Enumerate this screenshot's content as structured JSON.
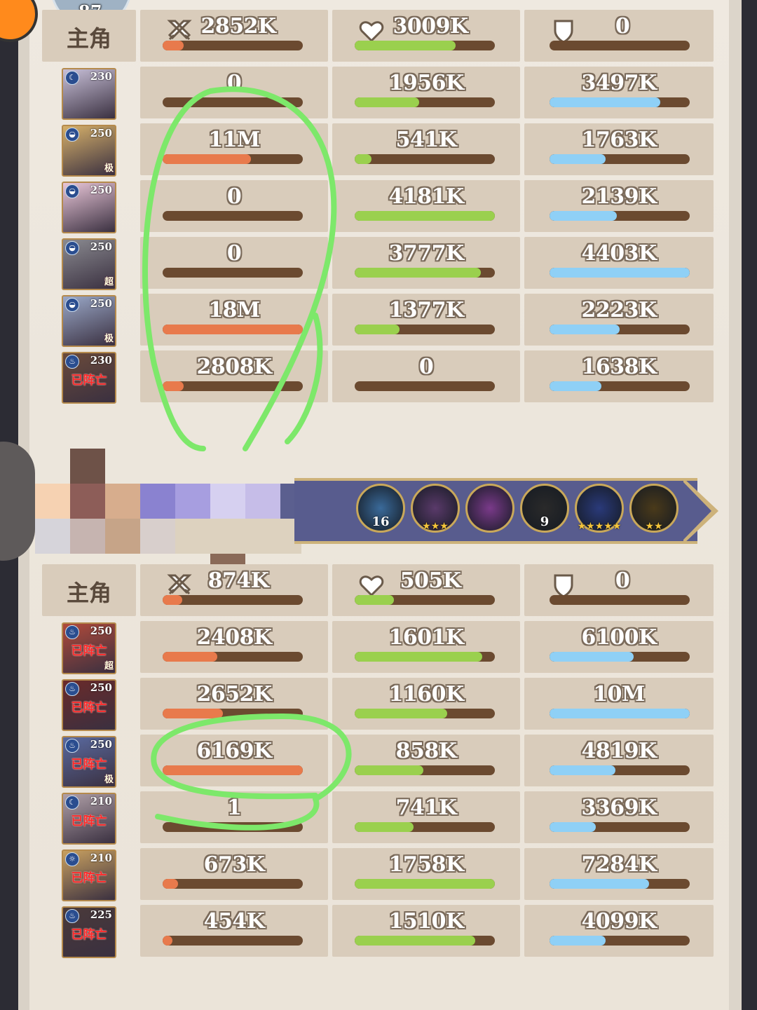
{
  "top_badge": {
    "level": "87"
  },
  "team1": {
    "header": {
      "label": "主角",
      "damage": "2852K",
      "damage_pct": 0.15,
      "heal": "3009K",
      "heal_pct": 0.72,
      "defense": "0",
      "defense_pct": 0
    },
    "rows": [
      {
        "portrait": {
          "level": "230",
          "element": "moon",
          "dead": "",
          "tag": ""
        },
        "damage": "0",
        "damage_pct": 0.0,
        "heal": "1956K",
        "heal_pct": 0.46,
        "defense": "3497K",
        "defense_pct": 0.79
      },
      {
        "portrait": {
          "level": "250",
          "element": "water",
          "dead": "",
          "tag": "极"
        },
        "damage": "11M",
        "damage_pct": 0.63,
        "heal": "541K",
        "heal_pct": 0.12,
        "defense": "1763K",
        "defense_pct": 0.4
      },
      {
        "portrait": {
          "level": "250",
          "element": "water",
          "dead": "",
          "tag": ""
        },
        "damage": "0",
        "damage_pct": 0.0,
        "heal": "4181K",
        "heal_pct": 1.0,
        "defense": "2139K",
        "defense_pct": 0.48
      },
      {
        "portrait": {
          "level": "250",
          "element": "water",
          "dead": "",
          "tag": "超"
        },
        "damage": "0",
        "damage_pct": 0.0,
        "heal": "3777K",
        "heal_pct": 0.9,
        "defense": "4403K",
        "defense_pct": 1.0
      },
      {
        "portrait": {
          "level": "250",
          "element": "water",
          "dead": "",
          "tag": "极"
        },
        "damage": "18M",
        "damage_pct": 1.0,
        "heal": "1377K",
        "heal_pct": 0.32,
        "defense": "2223K",
        "defense_pct": 0.5
      },
      {
        "portrait": {
          "level": "230",
          "element": "fire",
          "dead": "已阵亡",
          "tag": ""
        },
        "damage": "2808K",
        "damage_pct": 0.15,
        "heal": "0",
        "heal_pct": 0.0,
        "defense": "1638K",
        "defense_pct": 0.37
      }
    ]
  },
  "relics": [
    {
      "name": "ice-crystal-relic",
      "num": "16",
      "stars": ""
    },
    {
      "name": "purple-beast-relic",
      "num": "",
      "stars": "★★★"
    },
    {
      "name": "purple-armor-relic",
      "num": "",
      "stars": ""
    },
    {
      "name": "golden-trident-relic",
      "num": "9",
      "stars": ""
    },
    {
      "name": "blue-flower-relic",
      "num": "",
      "stars": "★★★★★"
    },
    {
      "name": "golden-axe-relic",
      "num": "",
      "stars": "★★"
    }
  ],
  "team2": {
    "header": {
      "label": "主角",
      "damage": "874K",
      "damage_pct": 0.14,
      "heal": "505K",
      "heal_pct": 0.28,
      "defense": "0",
      "defense_pct": 0
    },
    "rows": [
      {
        "portrait": {
          "level": "250",
          "element": "fire",
          "dead": "已阵亡",
          "tag": "超"
        },
        "damage": "2408K",
        "damage_pct": 0.39,
        "heal": "1601K",
        "heal_pct": 0.91,
        "defense": "6100K",
        "defense_pct": 0.6
      },
      {
        "portrait": {
          "level": "250",
          "element": "fire",
          "dead": "已阵亡",
          "tag": ""
        },
        "damage": "2652K",
        "damage_pct": 0.43,
        "heal": "1160K",
        "heal_pct": 0.66,
        "defense": "10M",
        "defense_pct": 1.0
      },
      {
        "portrait": {
          "level": "250",
          "element": "fire",
          "dead": "已阵亡",
          "tag": "极"
        },
        "damage": "6169K",
        "damage_pct": 1.0,
        "heal": "858K",
        "heal_pct": 0.49,
        "defense": "4819K",
        "defense_pct": 0.47
      },
      {
        "portrait": {
          "level": "210",
          "element": "moon",
          "dead": "已阵亡",
          "tag": ""
        },
        "damage": "1",
        "damage_pct": 0.0,
        "heal": "741K",
        "heal_pct": 0.42,
        "defense": "3369K",
        "defense_pct": 0.33
      },
      {
        "portrait": {
          "level": "210",
          "element": "sun",
          "dead": "已阵亡",
          "tag": ""
        },
        "damage": "673K",
        "damage_pct": 0.11,
        "heal": "1758K",
        "heal_pct": 1.0,
        "defense": "7284K",
        "defense_pct": 0.71
      },
      {
        "portrait": {
          "level": "225",
          "element": "fire",
          "dead": "已阵亡",
          "tag": ""
        },
        "damage": "454K",
        "damage_pct": 0.07,
        "heal": "1510K",
        "heal_pct": 0.86,
        "defense": "4099K",
        "defense_pct": 0.4
      }
    ]
  },
  "colors": {
    "damage_bar": "#e87a4c",
    "heal_bar": "#9ad04e",
    "defense_bar": "#8fd0f6",
    "bar_track": "#6b4a30",
    "highlight_marker": "#7de86a"
  }
}
